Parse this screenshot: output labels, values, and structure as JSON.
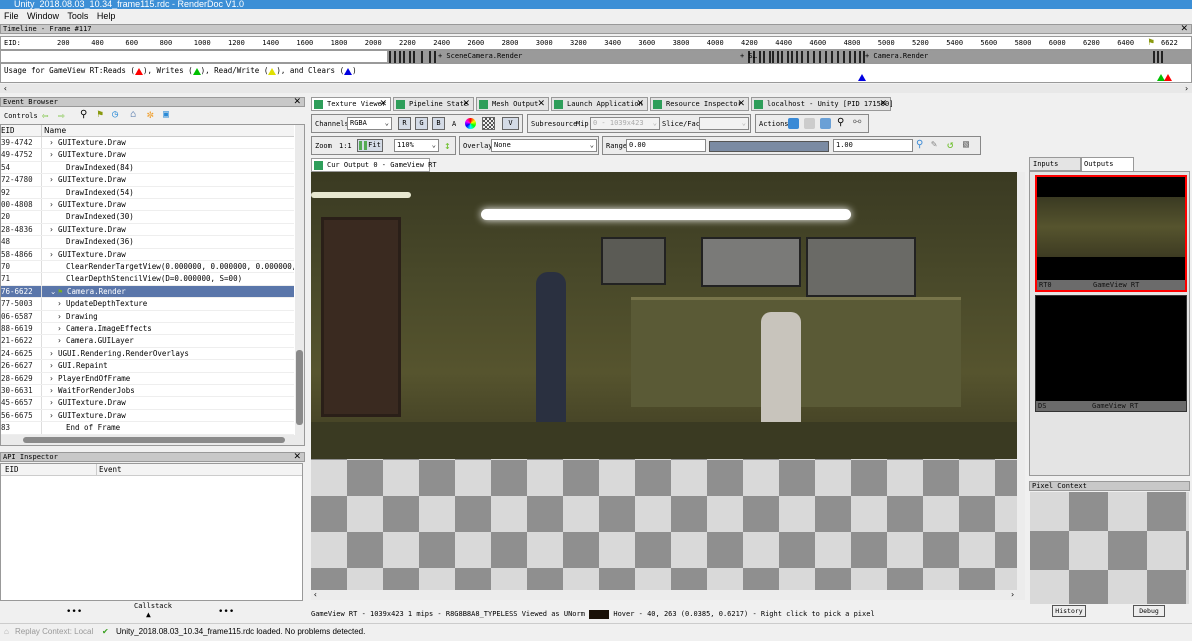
{
  "window": {
    "title": "Unity_2018.08.03_10.34_frame115.rdc - RenderDoc V1.0"
  },
  "menu": [
    "File",
    "Window",
    "Tools",
    "Help"
  ],
  "timeline": {
    "title": "Timeline - Frame #117",
    "eid_label": "EID:",
    "ticks": [
      "200",
      "400",
      "600",
      "800",
      "1000",
      "1200",
      "1400",
      "1600",
      "1800",
      "2000",
      "2200",
      "2400",
      "2600",
      "2800",
      "3000",
      "3200",
      "3400",
      "3600",
      "3800",
      "4000",
      "4200",
      "4400",
      "4600",
      "4800",
      "5000",
      "5200",
      "5400",
      "5600",
      "5800",
      "6000",
      "6200",
      "6400"
    ],
    "current": "6622",
    "markers": [
      "+ SceneCamera.Render",
      "+ S…",
      "+ Camera.Render"
    ],
    "usage": {
      "prefix": "Usage for GameView RT:",
      "reads": "Reads (",
      "writes": "), Writes (",
      "readwrite": "), Read/Write (",
      "clears": "), and Clears (",
      "end": ")"
    },
    "colors": {
      "read": "#e00000",
      "write": "#00c000",
      "readwrite": "#e0e000",
      "clear": "#0000e0"
    }
  },
  "event_browser": {
    "title": "Event Browser",
    "controls_label": "Controls",
    "col_eid": "EID",
    "col_name": "Name",
    "rows": [
      {
        "eid": "39-4742",
        "name": "GUITexture.Draw",
        "indent": 1,
        "expand": "›"
      },
      {
        "eid": "49-4752",
        "name": "GUITexture.Draw",
        "indent": 1,
        "expand": "›"
      },
      {
        "eid": "54",
        "name": "DrawIndexed(84)",
        "indent": 2,
        "expand": ""
      },
      {
        "eid": "72-4780",
        "name": "GUITexture.Draw",
        "indent": 1,
        "expand": "›"
      },
      {
        "eid": "92",
        "name": "DrawIndexed(54)",
        "indent": 2,
        "expand": ""
      },
      {
        "eid": "00-4808",
        "name": "GUITexture.Draw",
        "indent": 1,
        "expand": "›"
      },
      {
        "eid": "20",
        "name": "DrawIndexed(30)",
        "indent": 2,
        "expand": ""
      },
      {
        "eid": "28-4836",
        "name": "GUITexture.Draw",
        "indent": 1,
        "expand": "›"
      },
      {
        "eid": "48",
        "name": "DrawIndexed(36)",
        "indent": 2,
        "expand": ""
      },
      {
        "eid": "58-4866",
        "name": "GUITexture.Draw",
        "indent": 1,
        "expand": "›"
      },
      {
        "eid": "70",
        "name": "ClearRenderTargetView(0.000000, 0.000000, 0.000000, 0…",
        "indent": 2,
        "expand": ""
      },
      {
        "eid": "71",
        "name": "ClearDepthStencilView(D=0.000000, S=00)",
        "indent": 2,
        "expand": ""
      },
      {
        "eid": "76-6622",
        "name": "Camera.Render",
        "indent": 1,
        "expand": "⌄",
        "selected": true
      },
      {
        "eid": "77-5003",
        "name": "UpdateDepthTexture",
        "indent": 2,
        "expand": "›"
      },
      {
        "eid": "06-6587",
        "name": "Drawing",
        "indent": 2,
        "expand": "›"
      },
      {
        "eid": "88-6619",
        "name": "Camera.ImageEffects",
        "indent": 2,
        "expand": "›"
      },
      {
        "eid": "21-6622",
        "name": "Camera.GUILayer",
        "indent": 2,
        "expand": "›"
      },
      {
        "eid": "24-6625",
        "name": "UGUI.Rendering.RenderOverlays",
        "indent": 1,
        "expand": "›"
      },
      {
        "eid": "26-6627",
        "name": "GUI.Repaint",
        "indent": 1,
        "expand": "›"
      },
      {
        "eid": "28-6629",
        "name": "PlayerEndOfFrame",
        "indent": 1,
        "expand": "›"
      },
      {
        "eid": "30-6631",
        "name": "WaitForRenderJobs",
        "indent": 1,
        "expand": "›"
      },
      {
        "eid": "45-6657",
        "name": "GUITexture.Draw",
        "indent": 1,
        "expand": "›"
      },
      {
        "eid": "56-6675",
        "name": "GUITexture.Draw",
        "indent": 1,
        "expand": "›"
      },
      {
        "eid": "83",
        "name": "End of Frame",
        "indent": 2,
        "expand": ""
      }
    ]
  },
  "api_inspector": {
    "title": "API Inspector",
    "col_eid": "EID",
    "col_event": "Event",
    "callstack": "Callstack",
    "dots": "•••"
  },
  "tabs": [
    {
      "label": "Texture Viewer",
      "active": true
    },
    {
      "label": "Pipeline State"
    },
    {
      "label": "Mesh Output"
    },
    {
      "label": "Launch Application"
    },
    {
      "label": "Resource Inspector"
    },
    {
      "label": "localhost - Unity [PID 171500]"
    }
  ],
  "toolbar": {
    "channels_label": "Channels",
    "channels_value": "RGBA",
    "r": "R",
    "g": "G",
    "b": "B",
    "a": "A",
    "v": "V",
    "subresource_label": "Subresource",
    "mip_label": "Mip",
    "mip_value": "0 - 1039x423",
    "slice_label": "Slice/Face",
    "actions_label": "Actions",
    "zoom_label": "Zoom",
    "zoom_1to1": "1:1",
    "fit_label": "Fit",
    "zoom_value": "110%",
    "overlay_label": "Overlay",
    "overlay_value": "None",
    "range_label": "Range",
    "range_min": "0.00",
    "range_max": "1.00"
  },
  "output_tab": "Cur Output 0 - GameView RT",
  "texture_status": {
    "info": "GameView RT - 1039x423 1 mips - R8G8B8A8_TYPELESS Viewed as UNorm",
    "hover": "Hover -    40,  263 (0.0385, 0.6217) - Right click to pick a pixel"
  },
  "right_panel": {
    "tab_inputs": "Inputs",
    "tab_outputs": "Outputs",
    "thumbs": [
      {
        "slot": "RT0",
        "name": "GameView RT"
      },
      {
        "slot": "DS",
        "name": "GameView RT"
      }
    ],
    "pixel_context": "Pixel Context",
    "history": "History",
    "debug": "Debug"
  },
  "statusbar": {
    "replay": "Replay Context: Local",
    "message": "Unity_2018.08.03_10.34_frame115.rdc loaded. No problems detected."
  }
}
